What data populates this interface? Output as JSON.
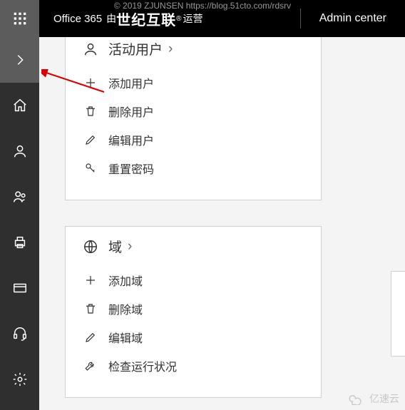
{
  "meta": {
    "copyright": "© 2019 ZJUNSEN https://blog.51cto.com/rdsrv",
    "watermark": "亿速云"
  },
  "header": {
    "brand_prefix": "Office 365",
    "brand_cn_lead": "由",
    "brand_cn_bold": "世纪互联",
    "brand_reg": "®",
    "brand_cn_tail": "运营",
    "admin_center": "Admin center"
  },
  "cards": {
    "users": {
      "title": "活动用户",
      "chevron": "›",
      "actions": {
        "add": "添加用户",
        "delete": "删除用户",
        "edit": "编辑用户",
        "reset": "重置密码"
      }
    },
    "domains": {
      "title": "域",
      "chevron": "›",
      "actions": {
        "add": "添加域",
        "delete": "删除域",
        "edit": "编辑域",
        "check": "检查运行状况"
      }
    }
  }
}
